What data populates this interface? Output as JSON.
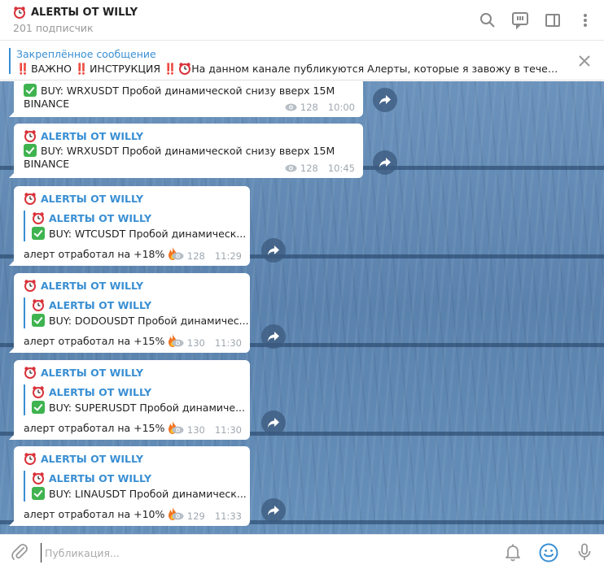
{
  "header": {
    "title": "ALERTЫ OT WILLY",
    "subscribers": "201 подписчик"
  },
  "pinned": {
    "title": "Закреплённое сообщение",
    "bang1": "‼️",
    "word1": "ВАЖНО",
    "bang2": "‼️",
    "word2": "ИНСТРУКЦИЯ",
    "bang3": "‼️",
    "text": "На данном канале публикуются Алерты, которые я завожу в течение..."
  },
  "messages": [
    {
      "text": "BUY: WRXUSDT Пробой динамической снизу вверх 15M",
      "exchange": "BINANCE",
      "views": "128",
      "time": "10:00"
    },
    {
      "author": "ALERTЫ OT WILLY",
      "text": "BUY: WRXUSDT Пробой динамической снизу вверх 15M",
      "exchange": "BINANCE",
      "views": "128",
      "time": "10:45"
    },
    {
      "author": "ALERTЫ OT WILLY",
      "fwd_author": "ALERTЫ OT WILLY",
      "fwd_text": "BUY: WTCUSDT Пробой динамическ...",
      "result": "алерт отработал на +18%",
      "views": "128",
      "time": "11:29"
    },
    {
      "author": "ALERTЫ OT WILLY",
      "fwd_author": "ALERTЫ OT WILLY",
      "fwd_text": "BUY: DODOUSDT Пробой динамичес...",
      "result": "алерт отработал на +15%",
      "views": "130",
      "time": "11:30"
    },
    {
      "author": "ALERTЫ OT WILLY",
      "fwd_author": "ALERTЫ OT WILLY",
      "fwd_text": "BUY: SUPERUSDT Пробой динамиче...",
      "result": "алерт отработал на +15%",
      "views": "130",
      "time": "11:30"
    },
    {
      "author": "ALERTЫ OT WILLY",
      "fwd_author": "ALERTЫ OT WILLY",
      "fwd_text": "BUY: LINAUSDT Пробой динамическ...",
      "result": "алерт отработал на +10%",
      "views": "129",
      "time": "11:33"
    }
  ],
  "composer": {
    "placeholder": "Публикация..."
  },
  "colors": {
    "accent": "#3a8fd3",
    "background": "#5d86b0"
  }
}
